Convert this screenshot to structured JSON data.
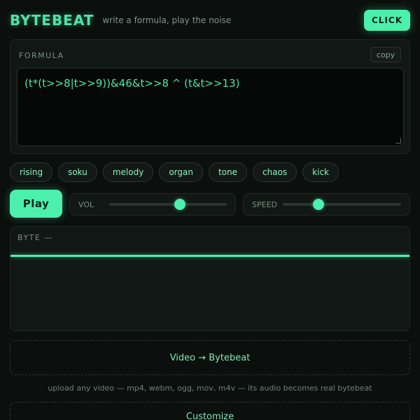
{
  "header": {
    "brand": "BYTEBEAT",
    "tagline": "write a formula, play the noise",
    "click_label": "CLICK"
  },
  "formula": {
    "label": "FORMULA",
    "copy_label": "copy",
    "value": "(t*(t>>8|t>>9))&46&t>>8 ^ (t&t>>13)"
  },
  "presets": [
    "rising",
    "soku",
    "melody",
    "organ",
    "tone",
    "chaos",
    "kick"
  ],
  "controls": {
    "play_label": "Play",
    "volume": {
      "label": "VOL",
      "value": 0.6
    },
    "speed": {
      "label": "SPEED",
      "value": 0.3
    }
  },
  "scope": {
    "label": "BYTE —"
  },
  "video": {
    "button_label": "Video → Bytebeat",
    "hint": "upload any video — mp4, webm, ogg, mov, m4v — its audio becomes real bytebeat"
  },
  "customize": {
    "label": "Customize"
  },
  "colors": {
    "accent": "#4cf0ad",
    "background": "#0b0f0d",
    "panel": "#111714"
  }
}
